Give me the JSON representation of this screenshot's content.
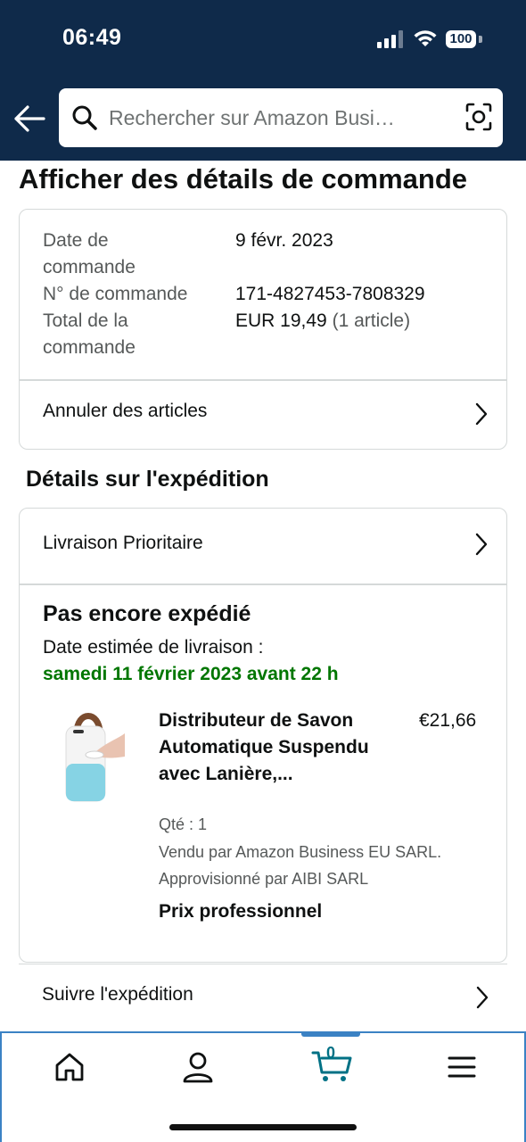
{
  "status_bar": {
    "time": "06:49",
    "battery": "100"
  },
  "search": {
    "placeholder": "Rechercher sur Amazon Busi…"
  },
  "page_title": "Afficher des détails de commande",
  "order_summary": {
    "date_label": "Date de commande",
    "date_value": "9 févr. 2023",
    "number_label": "N° de commande",
    "number_value": "171-4827453-7808329",
    "total_label": "Total de la commande",
    "total_value": "EUR 19,49",
    "total_items": "(1 article)",
    "cancel_label": "Annuler des articles"
  },
  "shipping": {
    "section_title": "Détails sur l'expédition",
    "delivery_option": "Livraison Prioritaire",
    "status": "Pas encore expédié",
    "estimate_label": "Date estimée de livraison :",
    "estimate_date": "samedi 11 février 2023 avant 22 h",
    "product": {
      "title": "Distributeur de Savon Automatique Suspendu avec Lanière,...",
      "price": "€21,66",
      "qty": "Qté : 1",
      "sold_by": "Vendu par Amazon Business EU SARL.",
      "supplied_by": "Approvisionné par AIBI SARL",
      "price_type": "Prix professionnel"
    },
    "track_label": "Suivre l'expédition"
  },
  "bottom_nav": {
    "items": [
      {
        "icon": "home-icon"
      },
      {
        "icon": "account-icon"
      },
      {
        "icon": "cart-icon",
        "count": "0"
      },
      {
        "icon": "menu-icon"
      }
    ],
    "accent_color": "#3b82c4"
  },
  "colors": {
    "header_bg": "#0f2a4a",
    "delivery_green": "#007600",
    "cart_teal": "#007185"
  }
}
